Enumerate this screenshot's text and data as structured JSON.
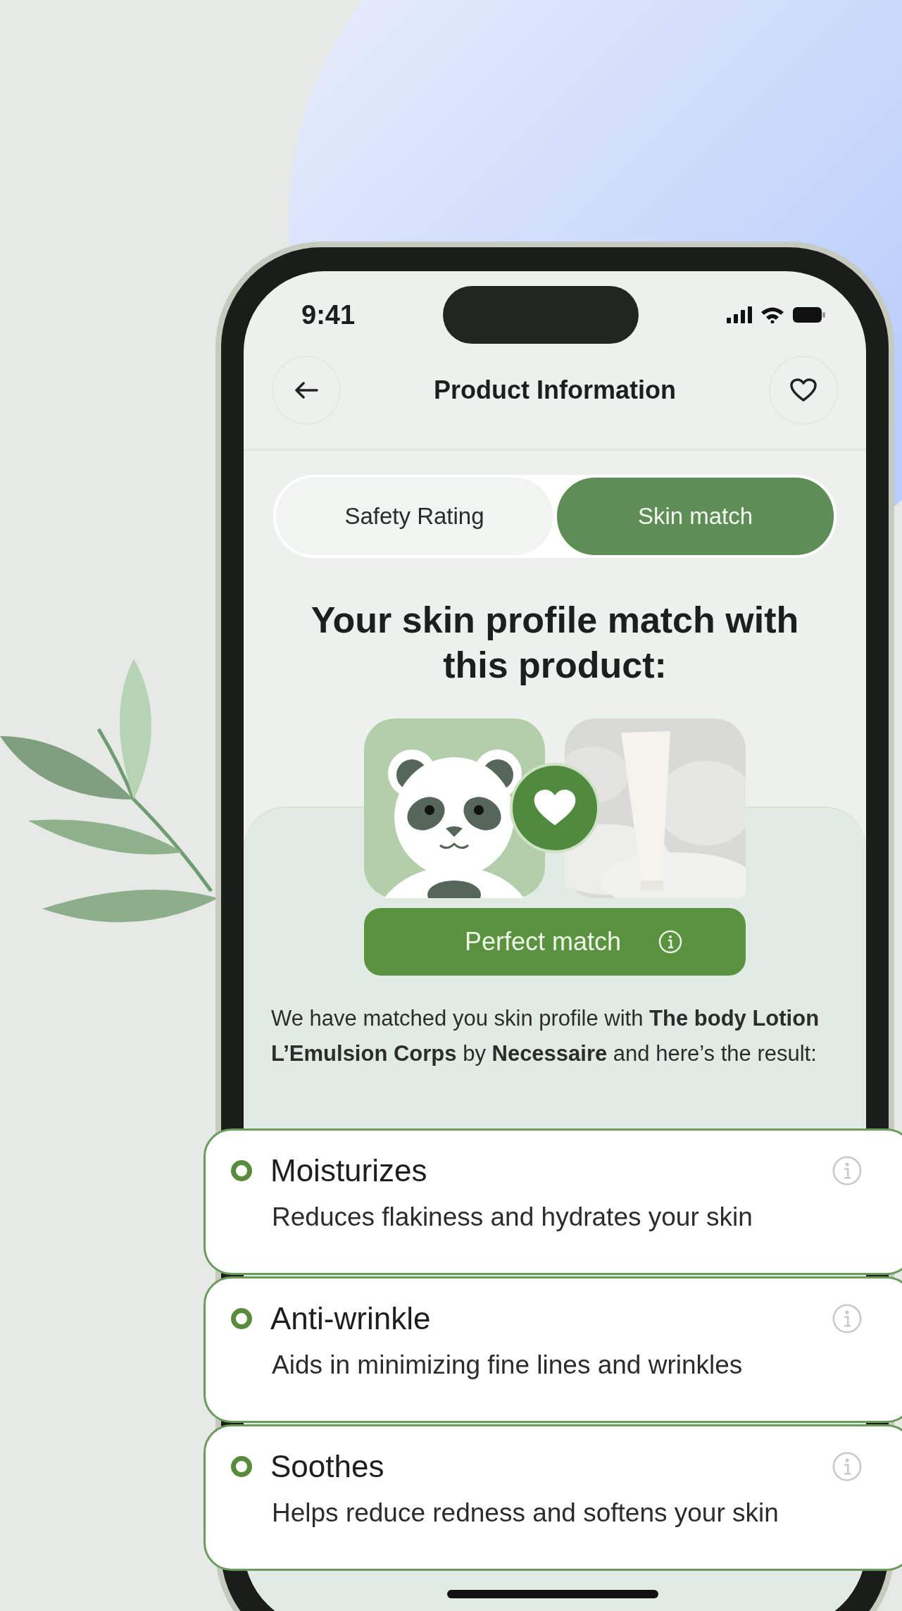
{
  "status_bar": {
    "time": "9:41"
  },
  "header": {
    "title": "Product Information"
  },
  "tabs": [
    {
      "label": "Safety Rating",
      "selected": false
    },
    {
      "label": "Skin match",
      "selected": true
    }
  ],
  "heading": "Your skin profile match with this product:",
  "match_badge": {
    "label": "Perfect match"
  },
  "description": "We have matched you skin profile with **The body Lotion L’Emulsion Corps** by **Necessaire** and here’s the result:",
  "benefits": [
    {
      "title": "Moisturizes",
      "description": "Reduces flakiness and hydrates your skin"
    },
    {
      "title": "Anti-wrinkle",
      "description": "Aids in minimizing fine lines and wrinkles"
    },
    {
      "title": "Soothes",
      "description": "Helps reduce redness and softens your skin"
    }
  ]
}
